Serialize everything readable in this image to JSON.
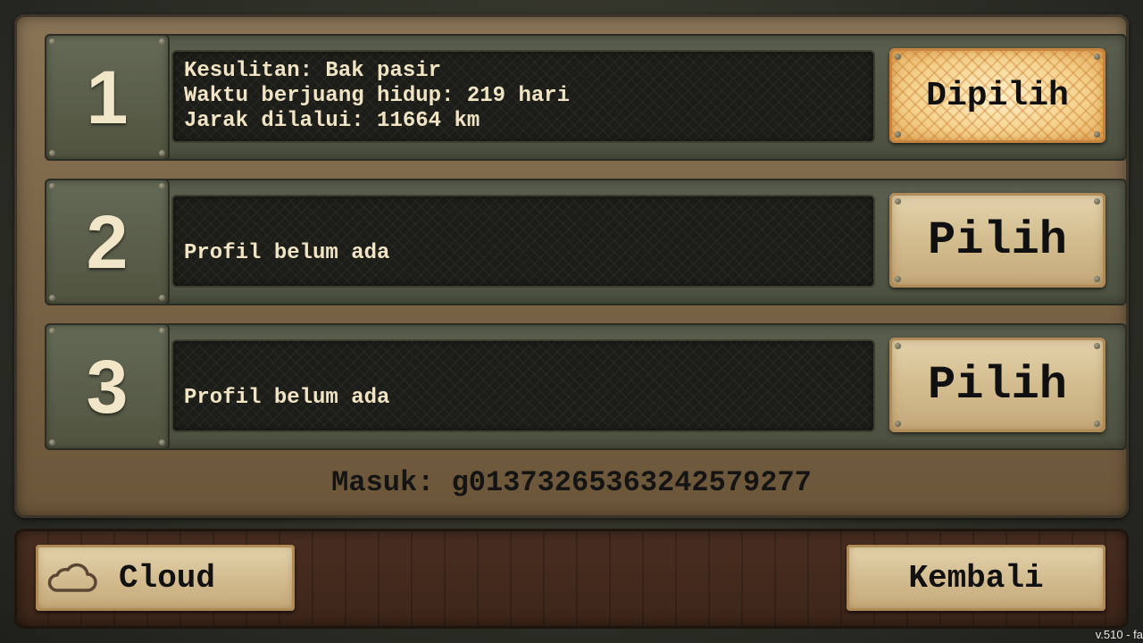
{
  "profiles": [
    {
      "number": "1",
      "lines": [
        "Kesulitan: Bak pasir",
        "Waktu berjuang hidup: 219 hari",
        "Jarak dilalui: 11664 km"
      ],
      "button_label": "Dipilih",
      "selected": true
    },
    {
      "number": "2",
      "empty_text": "Profil belum ada",
      "button_label": "Pilih",
      "selected": false
    },
    {
      "number": "3",
      "empty_text": "Profil belum ada",
      "button_label": "Pilih",
      "selected": false
    }
  ],
  "login_text": "Masuk: g01373265363242579277",
  "bottom_bar": {
    "cloud_label": "Cloud",
    "cloud_icon": "cloud-icon",
    "back_label": "Kembali"
  },
  "version_text": "v.510 - fa",
  "colors": {
    "panel_brown": "#7a6447",
    "slot_olive": "#4c503f",
    "info_dark": "#1c1d19",
    "text_cream": "#f1e4c4",
    "button_tan": "#d3bd8f",
    "selected_glow": "#f4d08a"
  }
}
